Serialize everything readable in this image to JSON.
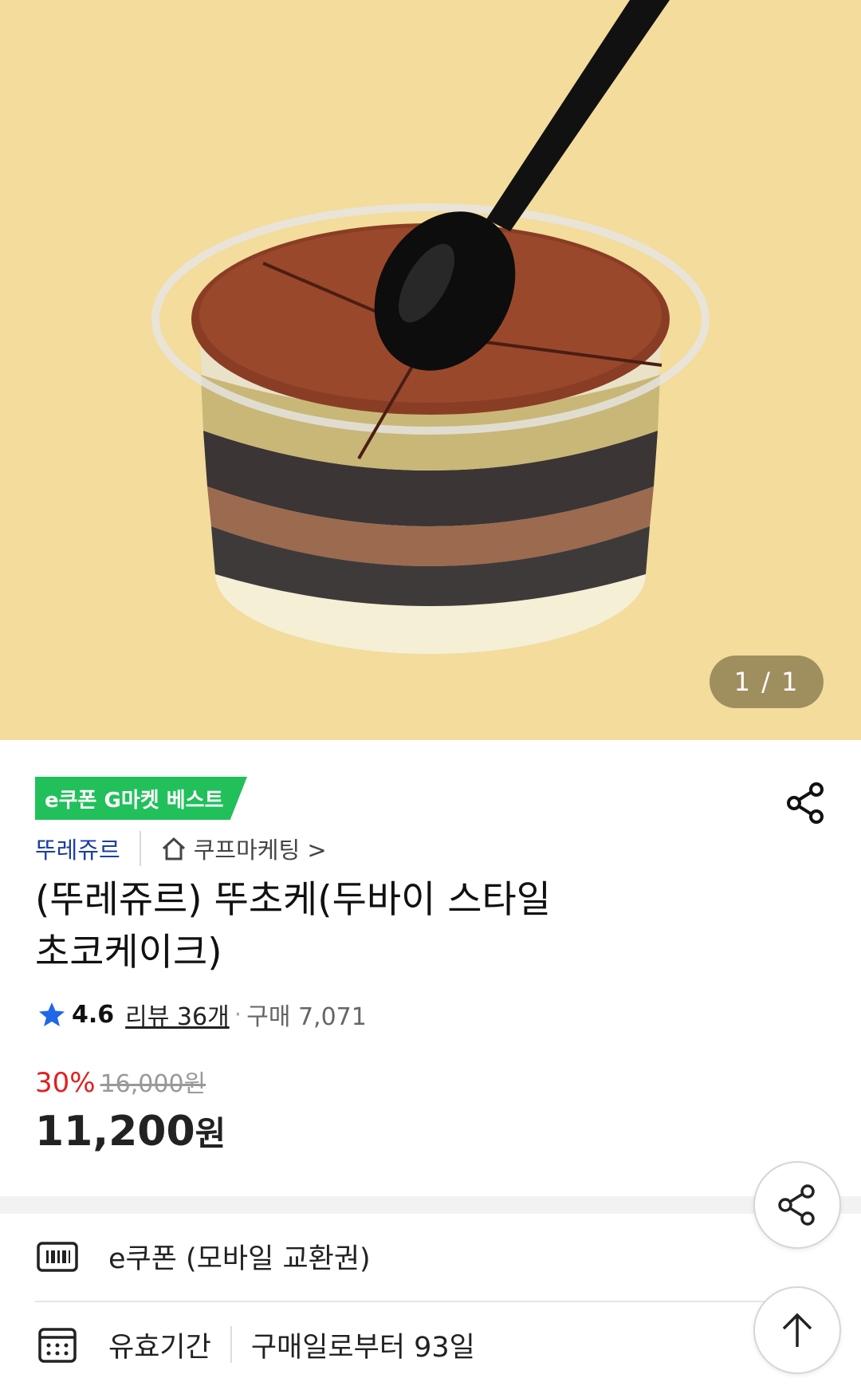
{
  "hero": {
    "counter": "1 / 1"
  },
  "badge": {
    "label": "e쿠폰 G마켓 베스트"
  },
  "shop": {
    "brand": "뚜레쥬르",
    "store": "쿠프마케팅 >"
  },
  "product": {
    "title_line1": "(뚜레쥬르) 뚜초케(두바이 스타일",
    "title_line2": "초코케이크)"
  },
  "rating": {
    "score": "4.6",
    "review": "리뷰 36개",
    "dot": "·",
    "purchases": "구매 7,071"
  },
  "price": {
    "discount": "30%",
    "original": "16,000원",
    "final": "11,200",
    "unit": "원"
  },
  "info": {
    "type": "e쿠폰 (모바일 교환권)",
    "validity_label": "유효기간",
    "validity_value": "구매일로부터 93일"
  },
  "icons": {
    "hero_share": "share-icon",
    "fab_share": "share-icon",
    "fab_top": "arrow-up-icon",
    "store": "home-icon",
    "star": "star-icon",
    "coupon": "barcode-icon",
    "calendar": "calendar-icon"
  },
  "colors": {
    "brand_blue": "#1a3fa3",
    "badge_green": "#21c05b",
    "discount_red": "#e02020",
    "hero_bg": "#f3dc9c"
  }
}
